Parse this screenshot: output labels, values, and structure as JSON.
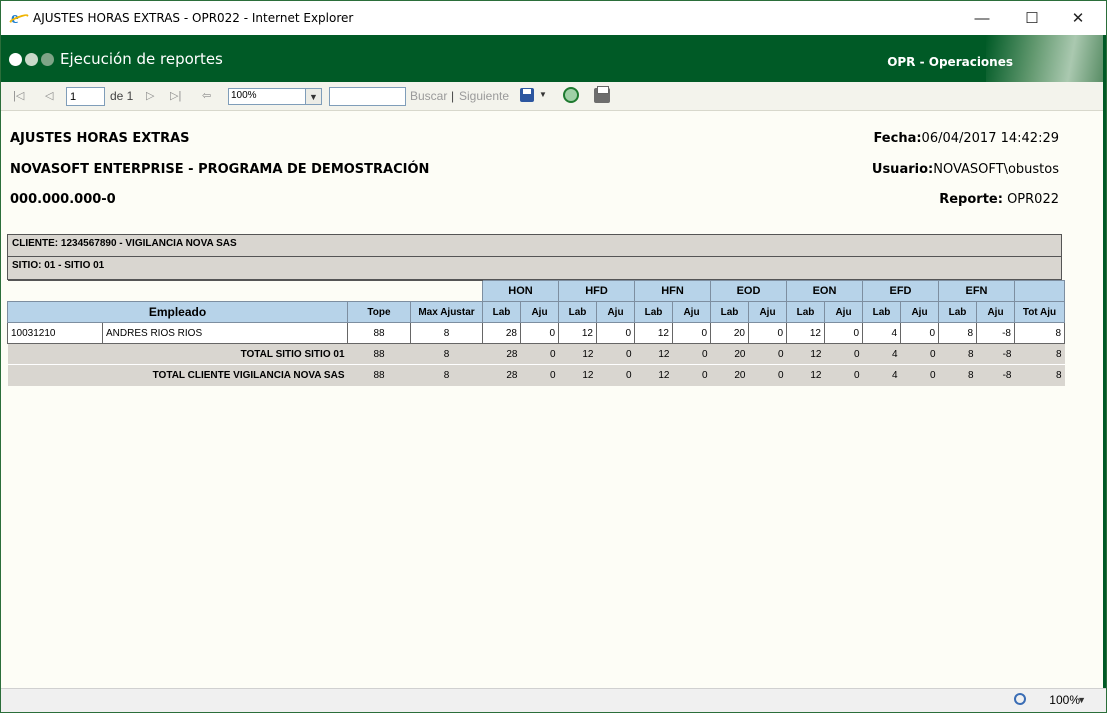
{
  "window": {
    "title": "AJUSTES HORAS EXTRAS - OPR022 - Internet Explorer"
  },
  "header": {
    "title": "Ejecución de reportes",
    "module": "OPR - Operaciones"
  },
  "toolbar": {
    "page_value": "1",
    "page_of": "de 1",
    "zoom": "100%",
    "search_placeholder": "",
    "search_label": "Buscar",
    "separator": "|",
    "next_label": "Siguiente"
  },
  "report": {
    "title": "AJUSTES HORAS EXTRAS",
    "company": "NOVASOFT ENTERPRISE - PROGRAMA DE DEMOSTRACIÓN",
    "nit": "000.000.000-0",
    "fecha_label": "Fecha:",
    "fecha_value": "06/04/2017 14:42:29",
    "usuario_label": "Usuario:",
    "usuario_value": "NOVASOFT\\obustos",
    "reporte_label": "Reporte:",
    "reporte_value": " OPR022",
    "cliente": "CLIENTE: 1234567890 - VIGILANCIA NOVA SAS",
    "sitio": "SITIO: 01 - SITIO 01",
    "groups": [
      "HON",
      "HFD",
      "HFN",
      "EOD",
      "EON",
      "EFD",
      "EFN"
    ],
    "col_empleado": "Empleado",
    "col_tope": "Tope",
    "col_max": "Max Ajustar",
    "col_lab": "Lab",
    "col_aju": "Aju",
    "col_totaju": "Tot Aju",
    "rows": [
      {
        "code": "10031210",
        "name": "ANDRES RIOS RIOS",
        "tope": "88",
        "max": "8",
        "vals": [
          "28",
          "0",
          "12",
          "0",
          "12",
          "0",
          "20",
          "0",
          "12",
          "0",
          "4",
          "0",
          "8",
          "-8"
        ],
        "tot": "8"
      }
    ],
    "totals": [
      {
        "label": "TOTAL SITIO SITIO 01",
        "tope": "88",
        "max": "8",
        "vals": [
          "28",
          "0",
          "12",
          "0",
          "12",
          "0",
          "20",
          "0",
          "12",
          "0",
          "4",
          "0",
          "8",
          "-8"
        ],
        "tot": "8"
      },
      {
        "label": "TOTAL CLIENTE VIGILANCIA NOVA SAS",
        "tope": "88",
        "max": "8",
        "vals": [
          "28",
          "0",
          "12",
          "0",
          "12",
          "0",
          "20",
          "0",
          "12",
          "0",
          "4",
          "0",
          "8",
          "-8"
        ],
        "tot": "8"
      }
    ]
  },
  "statusbar": {
    "zoom": "100%"
  },
  "colors": {
    "header_green": "#005a26",
    "column_header_blue": "#b7d3e9",
    "total_gray": "#d9d6d0"
  },
  "icons": [
    "ie-icon",
    "first-page-icon",
    "prev-page-icon",
    "next-page-icon",
    "last-page-icon",
    "back-icon",
    "save-icon",
    "refresh-icon",
    "print-icon",
    "zoom-icon"
  ]
}
